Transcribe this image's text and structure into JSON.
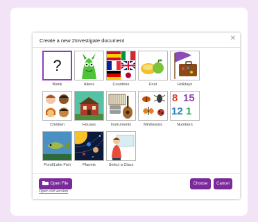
{
  "dialog": {
    "title": "Create a new 2Investigate document",
    "close_symbol": "✕"
  },
  "templates": [
    {
      "label": "Blank",
      "symbol": "?"
    },
    {
      "label": "Aliens"
    },
    {
      "label": "Countries"
    },
    {
      "label": "Fruit"
    },
    {
      "label": "Holidays"
    },
    {
      "label": "Children"
    },
    {
      "label": "Houses"
    },
    {
      "label": "Instruments"
    },
    {
      "label": "Minibeasts"
    },
    {
      "label": "Numbers",
      "digits": [
        "8",
        "15",
        "12",
        "1"
      ]
    },
    {
      "label": "Pond/Lake Fish"
    },
    {
      "label": "Planets"
    },
    {
      "label": "Select a Class"
    }
  ],
  "footer": {
    "open_file": "Open File",
    "open_old": "Open old version",
    "choose": "Choose",
    "cancel": "Cancel"
  },
  "colors": {
    "accent": "#7a2a9a",
    "background": "#f3e3f7"
  }
}
